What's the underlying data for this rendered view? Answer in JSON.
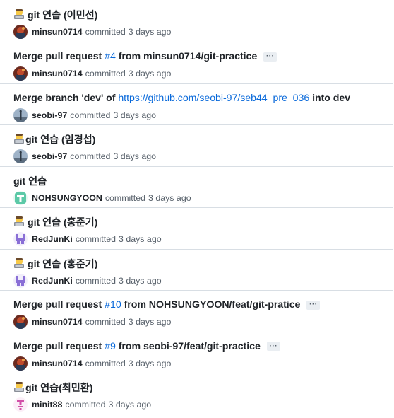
{
  "commits": [
    {
      "emoji": "technologist-emoji",
      "title_pre": "git 연습 (이민선)",
      "author": "minsun0714",
      "avatar": "minsun-avatar",
      "committed": "committed",
      "time": "3 days ago"
    },
    {
      "title_pre": "Merge pull request ",
      "pr_link": "#4",
      "title_post": " from minsun0714/git-practice",
      "more": "···",
      "author": "minsun0714",
      "avatar": "minsun-avatar",
      "committed": "committed",
      "time": "3 days ago"
    },
    {
      "title_pre": "Merge branch 'dev' of ",
      "url_link": "https://github.com/seobi-97/seb44_pre_036",
      "title_post": " into dev",
      "author": "seobi-97",
      "avatar": "seobi-avatar",
      "committed": "committed",
      "time": "3 days ago"
    },
    {
      "emoji": "technologist-emoji",
      "title_pre": "git 연습 (임경섭)",
      "author": "seobi-97",
      "avatar": "seobi-avatar",
      "committed": "committed",
      "time": "3 days ago"
    },
    {
      "title_pre": "git 연습",
      "author": "NOHSUNGYOON",
      "avatar": "nohsungyoon-avatar",
      "committed": "committed",
      "time": "3 days ago"
    },
    {
      "emoji": "technologist-emoji",
      "title_pre": "git 연습 (홍준기)",
      "author": "RedJunKi",
      "avatar": "redjunki-avatar",
      "committed": "committed",
      "time": "3 days ago"
    },
    {
      "emoji": "technologist-emoji",
      "title_pre": "git 연습 (홍준기)",
      "author": "RedJunKi",
      "avatar": "redjunki-avatar",
      "committed": "committed",
      "time": "3 days ago"
    },
    {
      "title_pre": "Merge pull request ",
      "pr_link": "#10",
      "title_post": " from NOHSUNGYOON/feat/git-pratice",
      "more": "···",
      "author": "minsun0714",
      "avatar": "minsun-avatar",
      "committed": "committed",
      "time": "3 days ago"
    },
    {
      "title_pre": "Merge pull request ",
      "pr_link": "#9",
      "title_post": " from seobi-97/feat/git-practice",
      "more": "···",
      "author": "minsun0714",
      "avatar": "minsun-avatar",
      "committed": "committed",
      "time": "3 days ago"
    },
    {
      "emoji": "technologist-emoji",
      "title_pre": "git 연습(최민환)",
      "author": "minit88",
      "avatar": "minit88-avatar",
      "committed": "committed",
      "time": "3 days ago"
    }
  ],
  "colors": {
    "link": "#0969da",
    "text": "#1f2328",
    "muted": "#57606a",
    "border": "#d8dee4"
  }
}
